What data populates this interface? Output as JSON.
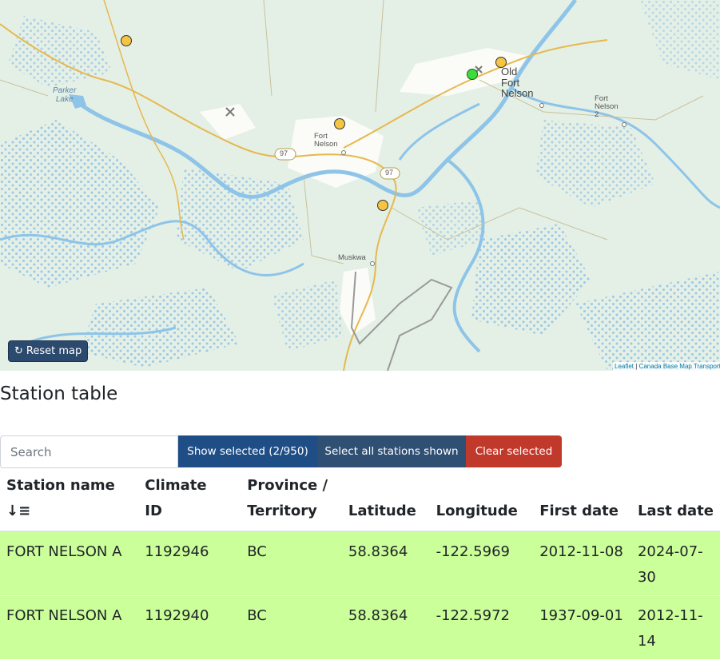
{
  "map": {
    "places": {
      "parker_lake": "Parker\nLake",
      "fort_nelson": "Fort\nNelson",
      "old_fort_nelson": "Old\nFort\nNelson",
      "fort_nelson_2": "Fort\nNelson\n2",
      "muskwa": "Muskwa"
    },
    "highway_shield": "97",
    "reset_label": "Reset map",
    "attribution_leaflet": "Leaflet",
    "attribution_sep": "|",
    "attribution_source": "Canada Base Map Transportation",
    "marker_colors": {
      "unselected": "#f5c542",
      "selected": "#3ddc3d"
    }
  },
  "station_table": {
    "title": "Station table",
    "search_placeholder": "Search",
    "buttons": {
      "show_selected": "Show selected (2/950)",
      "select_all": "Select all stations shown",
      "clear_selected": "Clear selected"
    },
    "headers": {
      "name": "Station name",
      "climate_id_1": "Climate",
      "climate_id_2": "ID",
      "province_1": "Province /",
      "province_2": "Territory",
      "latitude": "Latitude",
      "longitude": "Longitude",
      "first_date": "First date",
      "last_date": "Last date"
    },
    "rows": [
      {
        "name": "FORT NELSON A",
        "climate_id": "1192946",
        "province": "BC",
        "latitude": "58.8364",
        "longitude": "-122.5969",
        "first_date": "2012-11-08",
        "last_date": "2024-07-30"
      },
      {
        "name": "FORT NELSON A",
        "climate_id": "1192940",
        "province": "BC",
        "latitude": "58.8364",
        "longitude": "-122.5972",
        "first_date": "1937-09-01",
        "last_date": "2012-11-14"
      }
    ],
    "selected_row_color": "#cbff99"
  }
}
